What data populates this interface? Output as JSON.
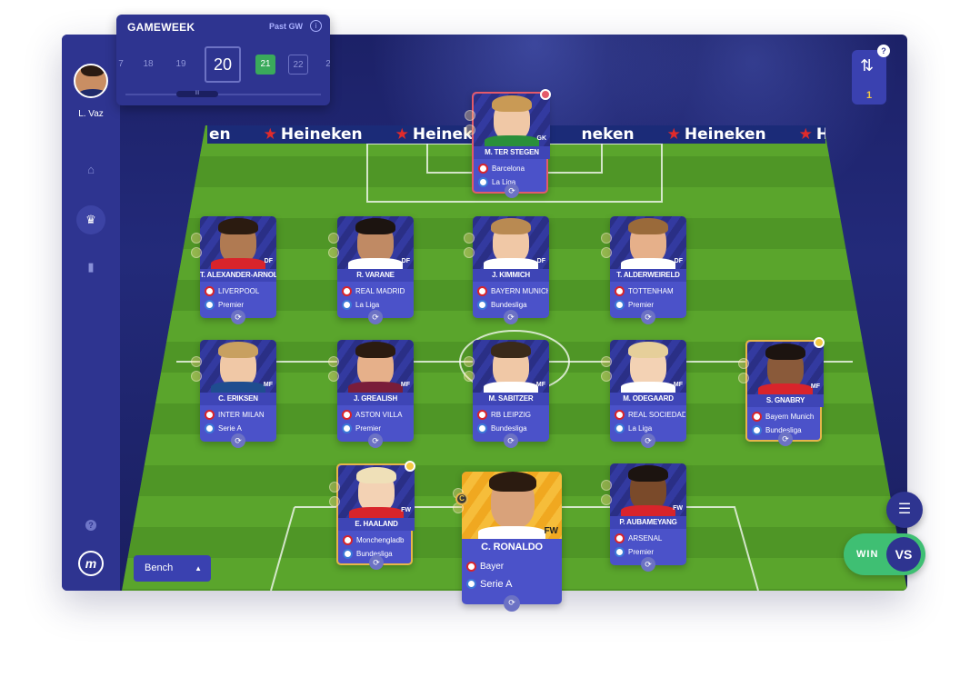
{
  "user": {
    "name": "L. Vaz"
  },
  "gameweek": {
    "title": "GAMEWEEK",
    "past_label": "Past GW",
    "info_icon": "i",
    "weeks": [
      "7",
      "18",
      "19",
      "20",
      "21",
      "22",
      "2"
    ],
    "current": "20",
    "scroll_handle": "III"
  },
  "transfers": {
    "count": "1",
    "help": "?",
    "icon": "swap-transfer-icon"
  },
  "adboard": [
    "en",
    "Heineken",
    "Heineken",
    "neken",
    "Heineken",
    "Heineken"
  ],
  "players": [
    {
      "name": "M. TER STEGEN",
      "pos": "GK",
      "club": "Barcelona",
      "league": "La Liga"
    },
    {
      "name": "T. ALEXANDER-ARNOLD",
      "pos": "DF",
      "club": "LIVERPOOL",
      "league": "Premier"
    },
    {
      "name": "R. VARANE",
      "pos": "DF",
      "club": "REAL MADRID",
      "league": "La Liga"
    },
    {
      "name": "J. KIMMICH",
      "pos": "DF",
      "club": "BAYERN MUNICH",
      "league": "Bundesliga"
    },
    {
      "name": "T. ALDERWEIRELD",
      "pos": "DF",
      "club": "TOTTENHAM",
      "league": "Premier"
    },
    {
      "name": "C. ERIKSEN",
      "pos": "MF",
      "club": "INTER MILAN",
      "league": "Serie A"
    },
    {
      "name": "J. GREALISH",
      "pos": "MF",
      "club": "ASTON VILLA",
      "league": "Premier"
    },
    {
      "name": "M. SABITZER",
      "pos": "MF",
      "club": "RB LEIPZIG",
      "league": "Bundesliga"
    },
    {
      "name": "M. ODEGAARD",
      "pos": "MF",
      "club": "REAL SOCIEDAD",
      "league": "La Liga"
    },
    {
      "name": "S. GNABRY",
      "pos": "MF",
      "club": "Bayern Munich",
      "league": "Bundesliga"
    },
    {
      "name": "E. HAALAND",
      "pos": "FW",
      "club": "Monchengladb",
      "league": "Bundesliga"
    },
    {
      "name": "C. RONALDO",
      "pos": "FW",
      "club": "Bayer",
      "league": "Serie A"
    },
    {
      "name": "P. AUBAMEYANG",
      "pos": "FW",
      "club": "ARSENAL",
      "league": "Premier"
    }
  ],
  "captain_marker": "C",
  "bench": {
    "label": "Bench",
    "arrow": "▲"
  },
  "controls": {
    "list_icon": "list-icon",
    "win": "WIN",
    "vs": "VS"
  },
  "colors": {
    "primary": "#2e3490",
    "accent": "#3fbf73",
    "gold": "#f3c842"
  }
}
